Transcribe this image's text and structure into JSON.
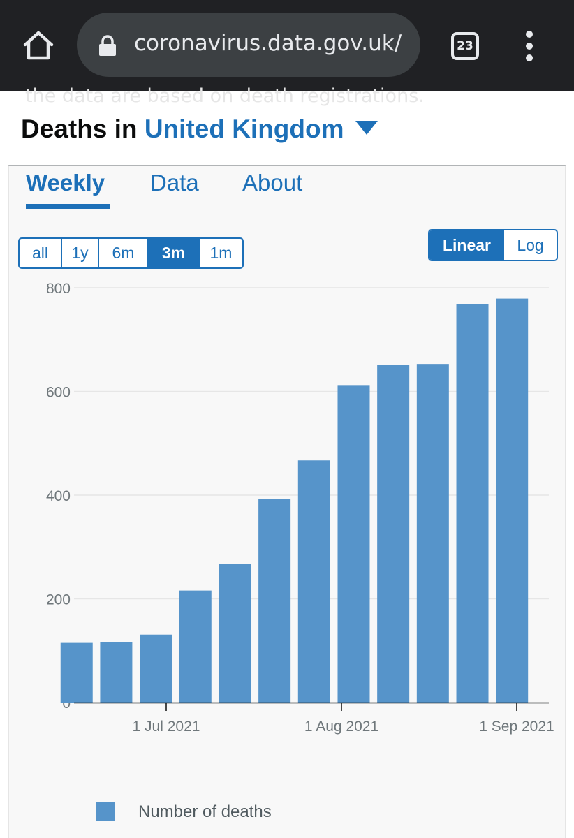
{
  "browser": {
    "url": "coronavirus.data.gov.uk/",
    "tab_count": "23",
    "icons": {
      "home": "home-icon",
      "lock": "lock-icon",
      "tabs": "tab-switcher-icon",
      "menu": "more-vert-icon"
    }
  },
  "page": {
    "faded_text": "the data are based on death registrations.",
    "heading_prefix": "Deaths in",
    "heading_place": "United Kingdom"
  },
  "tabs": [
    {
      "label": "Weekly",
      "active": true
    },
    {
      "label": "Data",
      "active": false
    },
    {
      "label": "About",
      "active": false
    }
  ],
  "range_buttons": [
    {
      "label": "all",
      "active": false
    },
    {
      "label": "1y",
      "active": false
    },
    {
      "label": "6m",
      "active": false
    },
    {
      "label": "3m",
      "active": true
    },
    {
      "label": "1m",
      "active": false
    }
  ],
  "scale_buttons": [
    {
      "label": "Linear",
      "active": true
    },
    {
      "label": "Log",
      "active": false
    }
  ],
  "colors": {
    "accent": "#1d70b8",
    "bar": "#5694ca",
    "text": "#0b0c0c"
  },
  "chart_data": {
    "type": "bar",
    "categories": [
      "2021-06-18",
      "2021-06-25",
      "2021-07-02",
      "2021-07-09",
      "2021-07-16",
      "2021-07-23",
      "2021-07-30",
      "2021-08-06",
      "2021-08-13",
      "2021-08-20",
      "2021-08-27",
      "2021-09-03"
    ],
    "series": [
      {
        "name": "Number of deaths",
        "values": [
          115,
          117,
          131,
          216,
          267,
          392,
          467,
          611,
          651,
          653,
          769,
          779
        ]
      }
    ],
    "y_ticks": [
      "0",
      "200",
      "400",
      "600",
      "800"
    ],
    "x_tick_labels": [
      "1 Jul 2021",
      "1 Aug 2021",
      "1 Sep 2021"
    ],
    "ylim": [
      0,
      800
    ],
    "grid": true,
    "legend_position": "bottom-left",
    "scale": "linear"
  }
}
